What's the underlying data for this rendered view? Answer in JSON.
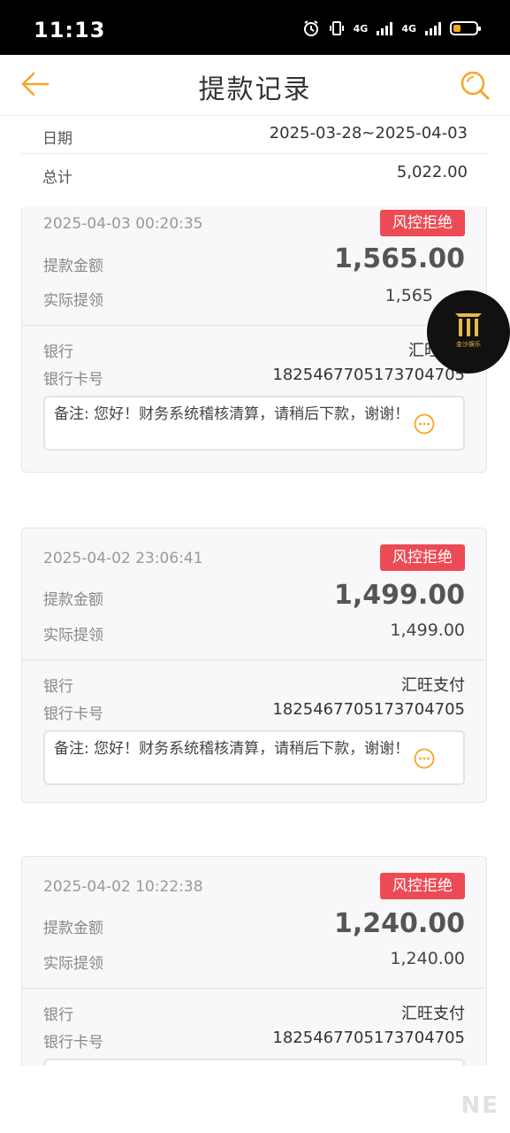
{
  "status_bar": {
    "time": "11:13",
    "net1": "4G",
    "net2": "4G"
  },
  "nav": {
    "title": "提款记录",
    "back_icon": "back-arrow-icon",
    "search_icon": "search-icon",
    "accent": "#f5a623"
  },
  "summary": {
    "date_label": "日期",
    "date_value": "2025-03-28~2025-04-03",
    "total_label": "总计",
    "total_value": "5,022.00"
  },
  "labels": {
    "amount": "提款金额",
    "actual": "实际提领",
    "bank": "银行",
    "card": "银行卡号"
  },
  "records": [
    {
      "time": "2025-04-03 00:20:35",
      "status": "风控拒绝",
      "amount": "1,565.00",
      "actual": "1,565",
      "bank": "汇旺",
      "card_no": "1825467705173704705",
      "note": "备注: 您好！财务系统稽核清算，请稍后下款，谢谢！"
    },
    {
      "time": "2025-04-02 23:06:41",
      "status": "风控拒绝",
      "amount": "1,499.00",
      "actual": "1,499.00",
      "bank": "汇旺支付",
      "card_no": "1825467705173704705",
      "note": "备注: 您好！财务系统稽核清算，请稍后下款，谢谢！"
    },
    {
      "time": "2025-04-02 10:22:38",
      "status": "风控拒绝",
      "amount": "1,240.00",
      "actual": "1,240.00",
      "bank": "汇旺支付",
      "card_no": "1825467705173704705"
    }
  ],
  "float_logo": {
    "text": "金沙娱乐"
  },
  "watermark": "NE",
  "colors": {
    "status_badge": "#ec4b55",
    "accent": "#f5a623"
  }
}
